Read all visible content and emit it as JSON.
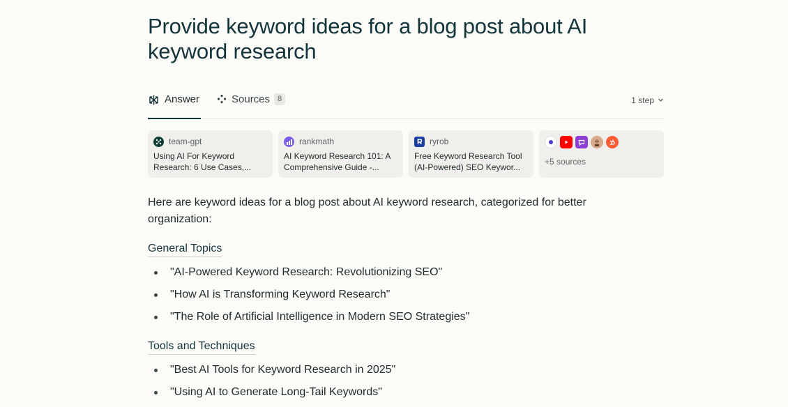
{
  "query": {
    "title": "Provide keyword ideas for a blog post about AI keyword research"
  },
  "tabs": {
    "answer_label": "Answer",
    "sources_label": "Sources",
    "sources_count": "8",
    "steps_label": "1 step"
  },
  "source_cards": [
    {
      "site": "team-gpt",
      "title": "Using AI For Keyword Research: 6 Use Cases,...",
      "favicon_color": "#0f3d33"
    },
    {
      "site": "rankmath",
      "title": "AI Keyword Research 101: A Comprehensive Guide -...",
      "favicon_color": "#6b4fd8"
    },
    {
      "site": "ryrob",
      "title": "Free Keyword Research Tool (AI-Powered) SEO Keywor...",
      "favicon_color": "#1b3fa0"
    }
  ],
  "more_sources": {
    "label": "+5 sources",
    "icons": [
      "circle-icon",
      "youtube-icon",
      "chat-icon",
      "avatar-icon",
      "hubspot-icon"
    ]
  },
  "answer": {
    "intro": "Here are keyword ideas for a blog post about AI keyword research, categorized for better organization:",
    "sections": [
      {
        "heading": "General Topics",
        "items": [
          "\"AI-Powered Keyword Research: Revolutionizing SEO\"",
          "\"How AI is Transforming Keyword Research\"",
          "\"The Role of Artificial Intelligence in Modern SEO Strategies\""
        ]
      },
      {
        "heading": "Tools and Techniques",
        "items": [
          "\"Best AI Tools for Keyword Research in 2025\"",
          "\"Using AI to Generate Long-Tail Keywords\""
        ]
      }
    ]
  },
  "colors": {
    "background": "#fbfbf8",
    "text": "#1f2a2b",
    "card_bg": "#f0efeb"
  }
}
